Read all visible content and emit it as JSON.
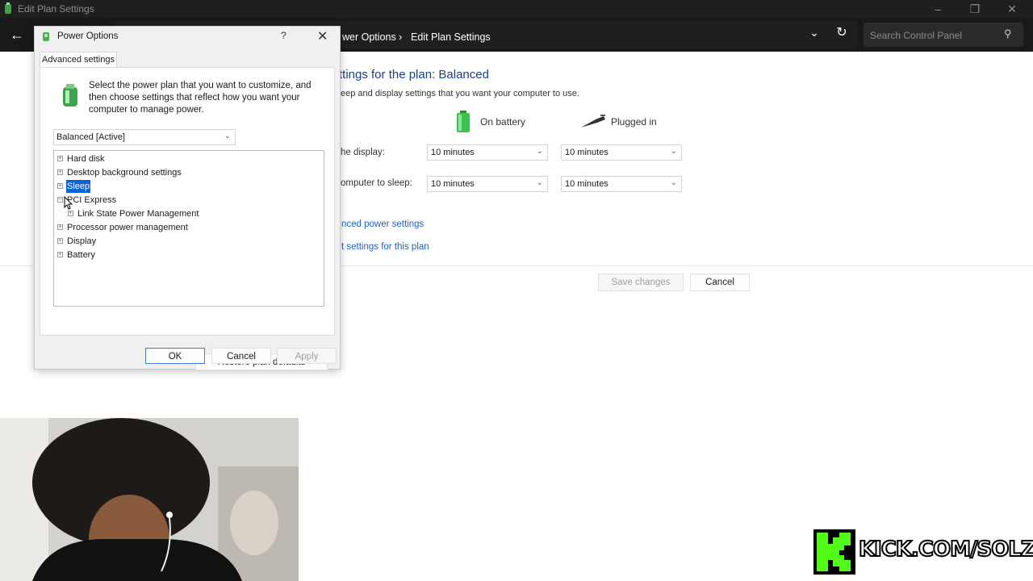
{
  "window": {
    "title": "Edit Plan Settings",
    "app_icon": "control-panel-icon"
  },
  "navbar": {
    "breadcrumb": [
      "wer Options",
      "Edit Plan Settings"
    ],
    "search_placeholder": "Search Control Panel"
  },
  "plan_settings": {
    "heading": "ttings for the plan: Balanced",
    "description": "eep and display settings that you want your computer to use.",
    "columns": {
      "battery": "On battery",
      "plugged": "Plugged in"
    },
    "rows": [
      {
        "label": "he display:",
        "battery": "10 minutes",
        "plugged": "10 minutes"
      },
      {
        "label": "omputer to sleep:",
        "battery": "10 minutes",
        "plugged": "10 minutes"
      }
    ],
    "links": [
      "nced power settings",
      "t settings for this plan"
    ],
    "save_label": "Save changes",
    "cancel_label": "Cancel"
  },
  "dialog": {
    "title": "Power Options",
    "help": "?",
    "tab": "Advanced settings",
    "description": "Select the power plan that you want to customize, and then choose settings that reflect how you want your computer to manage power.",
    "plan": "Balanced [Active]",
    "tree": [
      {
        "label": "Hard disk",
        "toggle": "+"
      },
      {
        "label": "Desktop background settings",
        "toggle": "+"
      },
      {
        "label": "Sleep",
        "toggle": "+",
        "selected": true
      },
      {
        "label": "PCI Express",
        "toggle": "−"
      },
      {
        "label": "Link State Power Management",
        "toggle": "+"
      },
      {
        "label": "Processor power management",
        "toggle": "+"
      },
      {
        "label": "Display",
        "toggle": "+"
      },
      {
        "label": "Battery",
        "toggle": "+"
      }
    ],
    "restore_label": "Restore plan defaults",
    "ok_label": "OK",
    "cancel_label": "Cancel",
    "apply_label": "Apply"
  },
  "overlay": {
    "kick_text": "KICK.COM/SOLZ"
  },
  "colors": {
    "accent": "#0a64d6",
    "link": "#1f5fbf",
    "heading": "#1e3f8a",
    "kick_green": "#53fc18"
  }
}
